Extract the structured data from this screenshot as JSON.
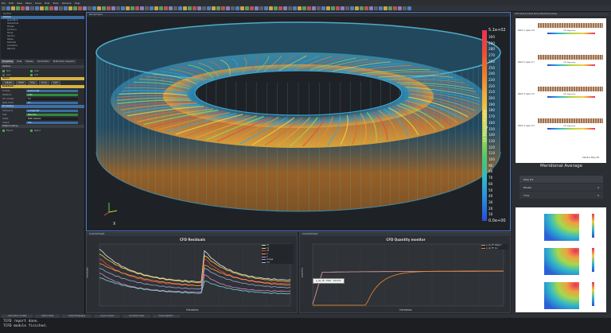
{
  "menu": [
    "File",
    "Edit",
    "View",
    "Mesh",
    "Solve",
    "Post",
    "Tools",
    "Window",
    "Help"
  ],
  "tree": {
    "items": [
      "Surface",
      "Surface",
      "Isosurface",
      "Streamline",
      "Probes",
      "Contours",
      "Slices",
      "Vectors",
      "Rakes",
      "Particles",
      "Animation",
      "Reports"
    ]
  },
  "left_tabs": [
    "Properties",
    "Data",
    "Display",
    "Information",
    "Multi-block inspector"
  ],
  "props": {
    "section1": "Options",
    "section2": "Solver",
    "section3": "Residuals",
    "section4": "Processing",
    "section5": "Postprocessing",
    "solver_btns": [
      "STEADY",
      "TFSTE",
      "TFSG",
      "TF-G4",
      "TOPT"
    ],
    "fields": [
      {
        "label": "Scheme",
        "value": "Second order"
      },
      {
        "label": "Iterations",
        "value": "1500"
      },
      {
        "label": "CFL number",
        "value": "5.0"
      },
      {
        "label": "Relax factor",
        "value": "0.7"
      },
      {
        "label": "Turbulence",
        "value": "k-omega SST"
      },
      {
        "label": "Inlet",
        "value": "Mass flow"
      },
      {
        "label": "Outlet",
        "value": "Static pressure"
      },
      {
        "label": "Output",
        "value": "VTK"
      }
    ]
  },
  "viewport": {
    "title": "RenderView1",
    "colorbar_title": "U Magnitude",
    "colorbar_max": "5.1e+02",
    "colorbar_min": "0.0e+00",
    "colorbar_ticks": [
      "300",
      "290",
      "280",
      "270",
      "260",
      "250",
      "240",
      "230",
      "220",
      "210",
      "200",
      "190",
      "180",
      "170",
      "160",
      "150",
      "140",
      "130",
      "120",
      "110",
      "100",
      "90",
      "80",
      "70",
      "60",
      "50",
      "40",
      "30",
      "20",
      "10"
    ]
  },
  "chart_left": {
    "header": "LineChartView1",
    "title": "CFD Residuals",
    "xlabel": "Iterations",
    "ylabel": "residuals",
    "legend": [
      "Ux",
      "Uy",
      "Uz",
      "p",
      "k",
      "omega",
      "rho"
    ]
  },
  "chart_right": {
    "header": "LineChartView2",
    "title": "CFD Quantity monitor",
    "xlabel": "Iterations",
    "ylabel": "quantity",
    "legend": [
      "p_rel_TE stage 1",
      "p_rel_TE (1-)"
    ],
    "tooltip": "p_rel_TE: 1500 : 101325"
  },
  "right_panel": {
    "header": "CFD blade-to-blade Slices (Meridional plane)",
    "slices": [
      "Patch 1: span 0.9",
      "Patch 2: span 0.7",
      "Patch 3: span 0.5",
      "Patch 4: span 0.3"
    ],
    "slice_label": "CFD Magnitude",
    "footer": "Cellular Strip #1",
    "meridional_title": "Meridional Average",
    "meridional_rows": [
      {
        "label": "Strip #1",
        "value": ""
      },
      {
        "label": "Blades",
        "value": "2"
      },
      {
        "label": "Time",
        "value": "0"
      }
    ]
  },
  "bottom_tabs": [
    "Information & Stats",
    "Python Shell",
    "Output Messages",
    "Log & Console",
    "Animation View",
    "Time Inspector"
  ],
  "log": [
    "TCFD report done.",
    "TCFD module finished."
  ],
  "colors": {
    "accent": "#4a78c8",
    "yellow": "#d6b441",
    "blue": "#3f6ea3",
    "green": "#2f8a3b"
  }
}
